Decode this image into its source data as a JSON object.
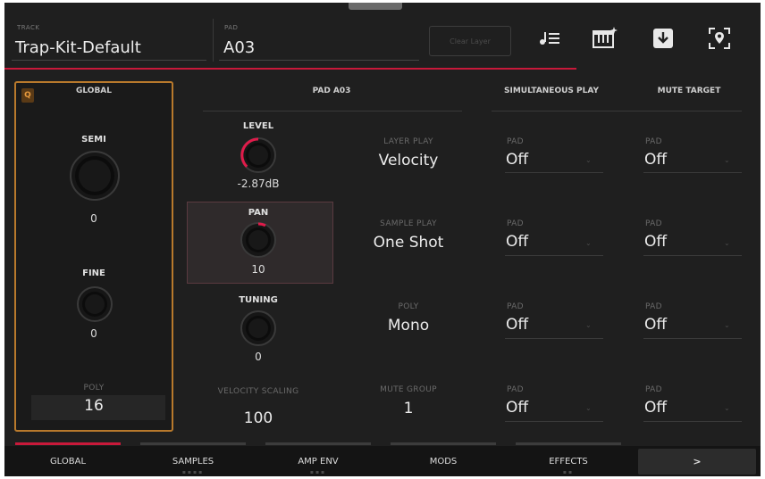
{
  "header": {
    "track_label": "TRACK",
    "track_name": "Trap-Kit-Default",
    "pad_label": "PAD",
    "pad_name": "A03",
    "clear_layer": "Clear Layer",
    "icons": [
      "note-list-icon",
      "keyboard-sparkle-icon",
      "download-icon",
      "location-pin-icon"
    ]
  },
  "global": {
    "badge": "Q",
    "title": "GLOBAL",
    "semi_label": "SEMI",
    "semi_value": "0",
    "fine_label": "FINE",
    "fine_value": "0",
    "poly_label": "POLY",
    "poly_value": "16"
  },
  "pad_section": {
    "title": "PAD A03",
    "level_label": "LEVEL",
    "level_value": "-2.87dB",
    "pan_label": "PAN",
    "pan_value": "10",
    "tuning_label": "TUNING",
    "tuning_value": "0",
    "velocity_scaling_label": "VELOCITY SCALING",
    "velocity_scaling_value": "100",
    "layer_play_label": "LAYER PLAY",
    "layer_play_value": "Velocity",
    "sample_play_label": "SAMPLE PLAY",
    "sample_play_value": "One Shot",
    "poly_label": "POLY",
    "poly_value": "Mono",
    "mute_group_label": "MUTE GROUP",
    "mute_group_value": "1"
  },
  "simultaneous_play": {
    "title": "SIMULTANEOUS PLAY",
    "slots": [
      {
        "label": "PAD",
        "value": "Off"
      },
      {
        "label": "PAD",
        "value": "Off"
      },
      {
        "label": "PAD",
        "value": "Off"
      },
      {
        "label": "PAD",
        "value": "Off"
      }
    ]
  },
  "mute_target": {
    "title": "MUTE TARGET",
    "slots": [
      {
        "label": "PAD",
        "value": "Off"
      },
      {
        "label": "PAD",
        "value": "Off"
      },
      {
        "label": "PAD",
        "value": "Off"
      },
      {
        "label": "PAD",
        "value": "Off"
      }
    ]
  },
  "tabs": [
    {
      "label": "GLOBAL",
      "active": true
    },
    {
      "label": "SAMPLES",
      "active": false
    },
    {
      "label": "AMP ENV",
      "active": false
    },
    {
      "label": "MODS",
      "active": false
    },
    {
      "label": "EFFECTS",
      "active": false
    }
  ],
  "next_label": ">",
  "colors": {
    "accent_red": "#c8193a",
    "global_border": "#b8792c",
    "background": "#1f1f1f"
  }
}
